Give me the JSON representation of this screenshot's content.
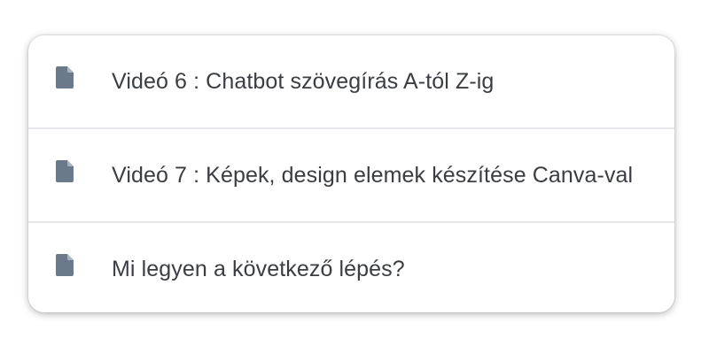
{
  "lesson_list": {
    "items": [
      {
        "icon": "document-icon",
        "label": "Videó 6 : Chatbot szövegírás A-tól Z-ig"
      },
      {
        "icon": "document-icon",
        "label": "Videó 7 : Képek, design elemek készítése Canva-val"
      },
      {
        "icon": "document-icon",
        "label": "Mi legyen a következő lépés?"
      }
    ]
  },
  "colors": {
    "icon": "#6b7a8a",
    "text": "#3a3d42",
    "divider": "#e6e7ea"
  }
}
